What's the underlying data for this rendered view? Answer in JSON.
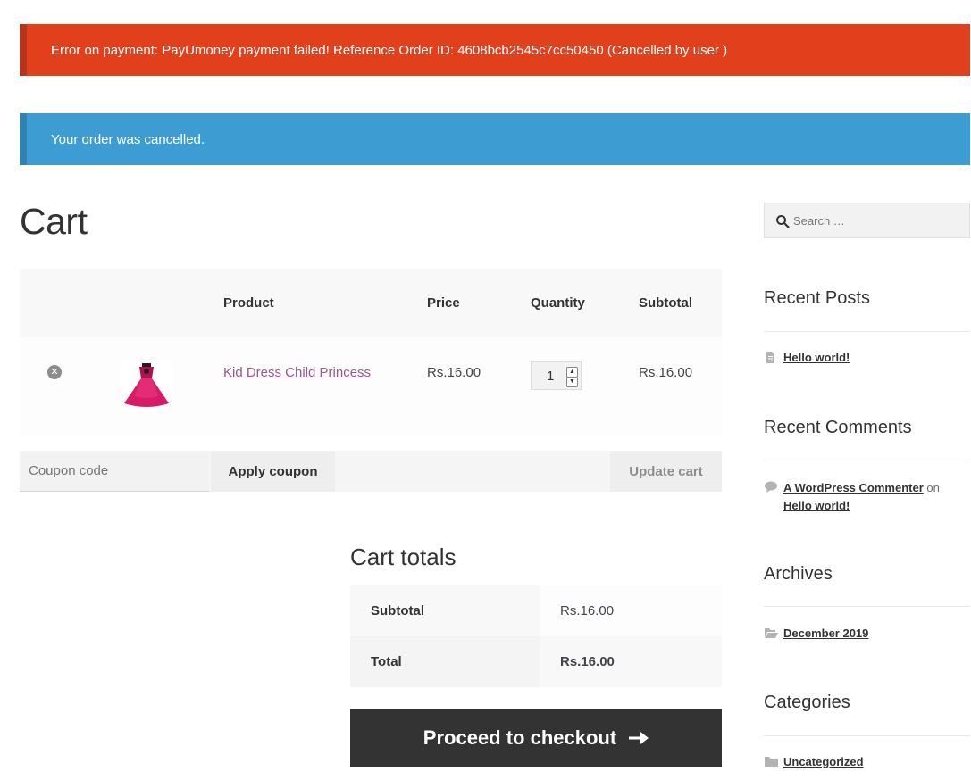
{
  "notices": {
    "error": "Error on payment: PayUmoney payment failed! Reference Order ID: 4608bcb2545c7cc50450 (Cancelled by user )",
    "info": "Your order was cancelled."
  },
  "page_title": "Cart",
  "cart": {
    "headers": {
      "product": "Product",
      "price": "Price",
      "quantity": "Quantity",
      "subtotal": "Subtotal"
    },
    "items": [
      {
        "remove_icon": "remove-circle-icon",
        "product": "Kid Dress Child Princess",
        "price": "Rs.16.00",
        "quantity": "1",
        "subtotal": "Rs.16.00"
      }
    ],
    "coupon_placeholder": "Coupon code",
    "apply_coupon": "Apply coupon",
    "update_cart": "Update cart"
  },
  "cart_totals": {
    "title": "Cart totals",
    "subtotal_label": "Subtotal",
    "subtotal_value": "Rs.16.00",
    "total_label": "Total",
    "total_value": "Rs.16.00",
    "checkout_button": "Proceed to checkout",
    "checkout_icon": "arrow-right-icon"
  },
  "sidebar": {
    "search_placeholder": "Search …",
    "recent_posts": {
      "title": "Recent Posts",
      "items": [
        "Hello world!"
      ]
    },
    "recent_comments": {
      "title": "Recent Comments",
      "items": [
        {
          "author": "A WordPress Commenter",
          "connector": "on",
          "post": "Hello world!"
        }
      ]
    },
    "archives": {
      "title": "Archives",
      "items": [
        "December 2019"
      ]
    },
    "categories": {
      "title": "Categories",
      "items": [
        "Uncategorized"
      ]
    }
  },
  "colors": {
    "error_bg": "#e2401c",
    "info_bg": "#3d9cd2",
    "link": "#96588a",
    "checkout_bg": "#333333"
  }
}
